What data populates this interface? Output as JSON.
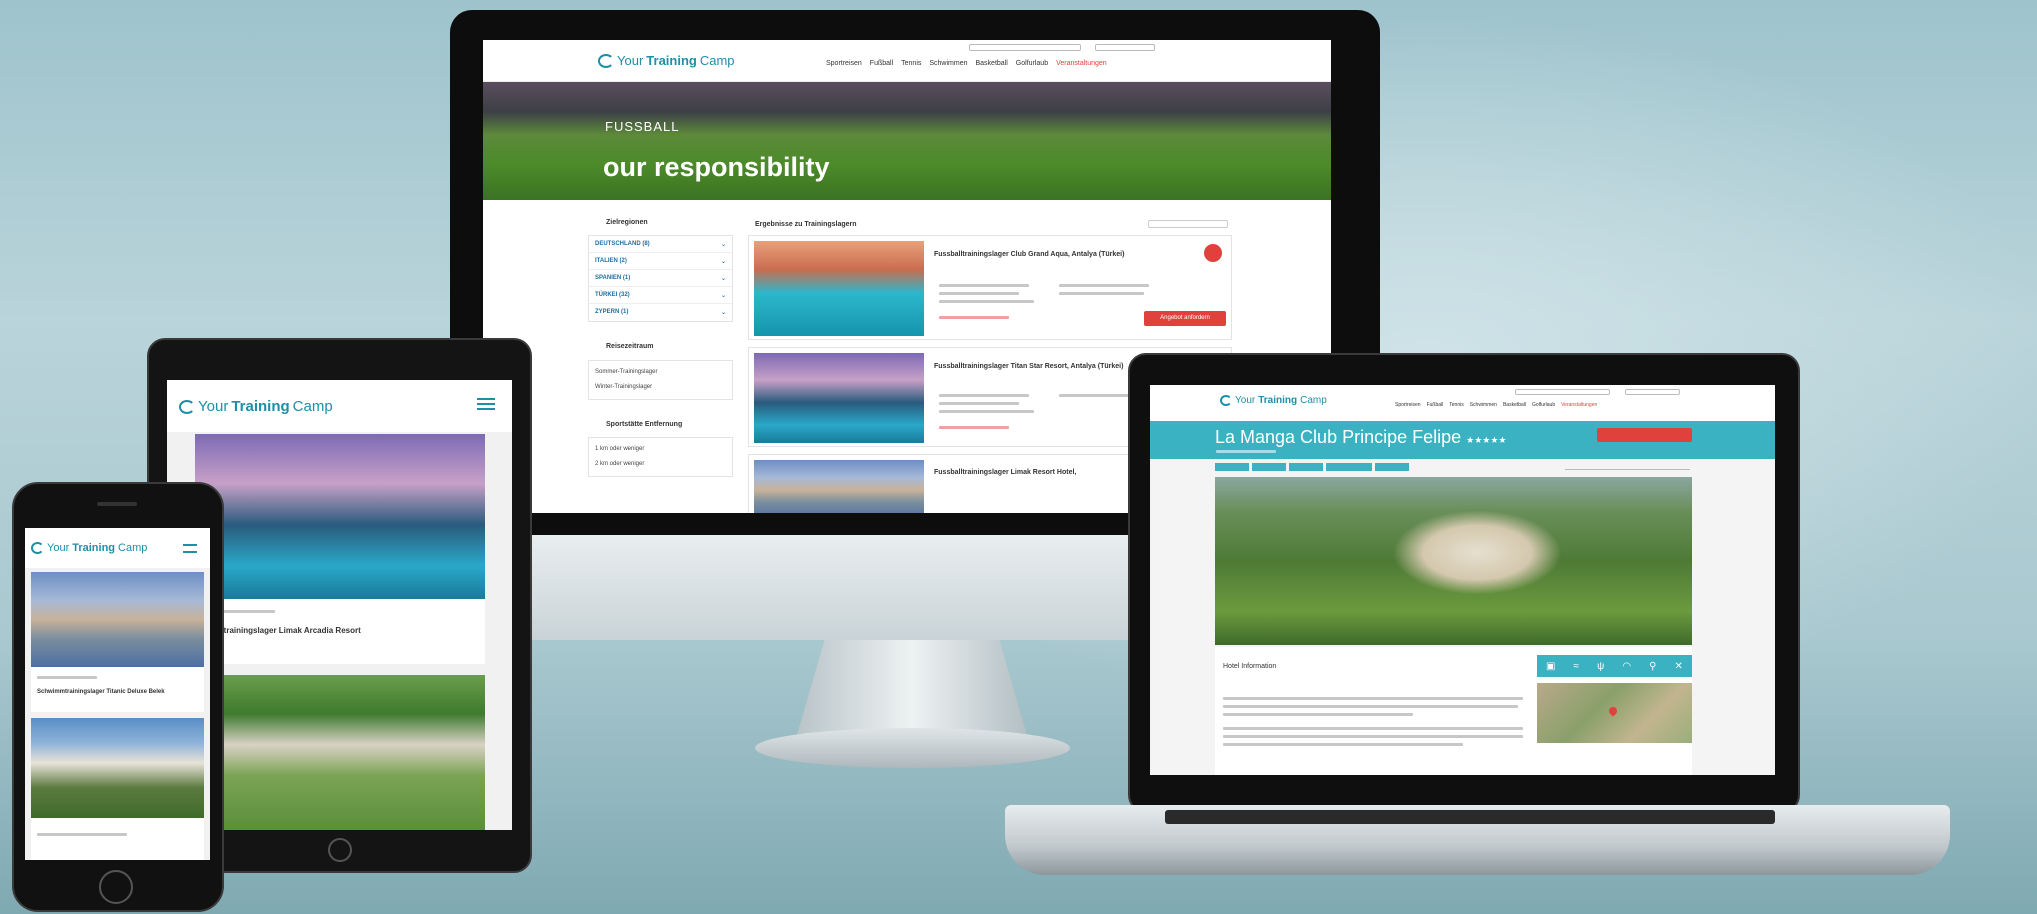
{
  "brand": {
    "logo_prefix": "Your",
    "logo_strong": "Training",
    "logo_suffix": "Camp"
  },
  "desktop": {
    "nav": [
      "Sportreisen",
      "Fußball",
      "Tennis",
      "Schwimmen",
      "Basketball",
      "Golfurlaub",
      "Veranstaltungen"
    ],
    "hero": {
      "small": "FUSSBALL",
      "title": "our responsibility"
    },
    "filters": {
      "zielregion_title": "Zielregionen",
      "regions": [
        "DEUTSCHLAND (8)",
        "ITALIEN (2)",
        "SPANIEN (1)",
        "TÜRKEI (32)",
        "ZYPERN (1)"
      ],
      "reisezeitraum_title": "Reisezeitraum",
      "reisezeitraum_options": [
        "Sommer-Trainingslager",
        "Winter-Trainingslager"
      ],
      "entfernung_title": "Sportstätte Entfernung",
      "entfernung_options": [
        "1 km oder weniger",
        "2 km oder weniger"
      ]
    },
    "results_title": "Ergebnisse zu Trainingslagern",
    "results": [
      {
        "title": "Fussballtrainingslager Club Grand Aqua, Antalya (Türkei)",
        "cta": "Angebot anfordern"
      },
      {
        "title": "Fussballtrainingslager Titan Star Resort, Antalya (Türkei)"
      },
      {
        "title": "Fussballtrainingslager Limak Resort Hotel,"
      }
    ]
  },
  "laptop": {
    "title": "La Manga Club Principe Felipe",
    "stars": "★★★★★",
    "section": "Hotel Information"
  },
  "tablet": {
    "card_title": "ballbtrainingslager Limak Arcadia Resort"
  },
  "phone": {
    "card_title": "Schwimmtrainingslager Titanic Deluxe Belek"
  },
  "colors": {
    "accent": "#1d8fa6",
    "red": "#e0413d",
    "teal": "#3bb2c2"
  }
}
